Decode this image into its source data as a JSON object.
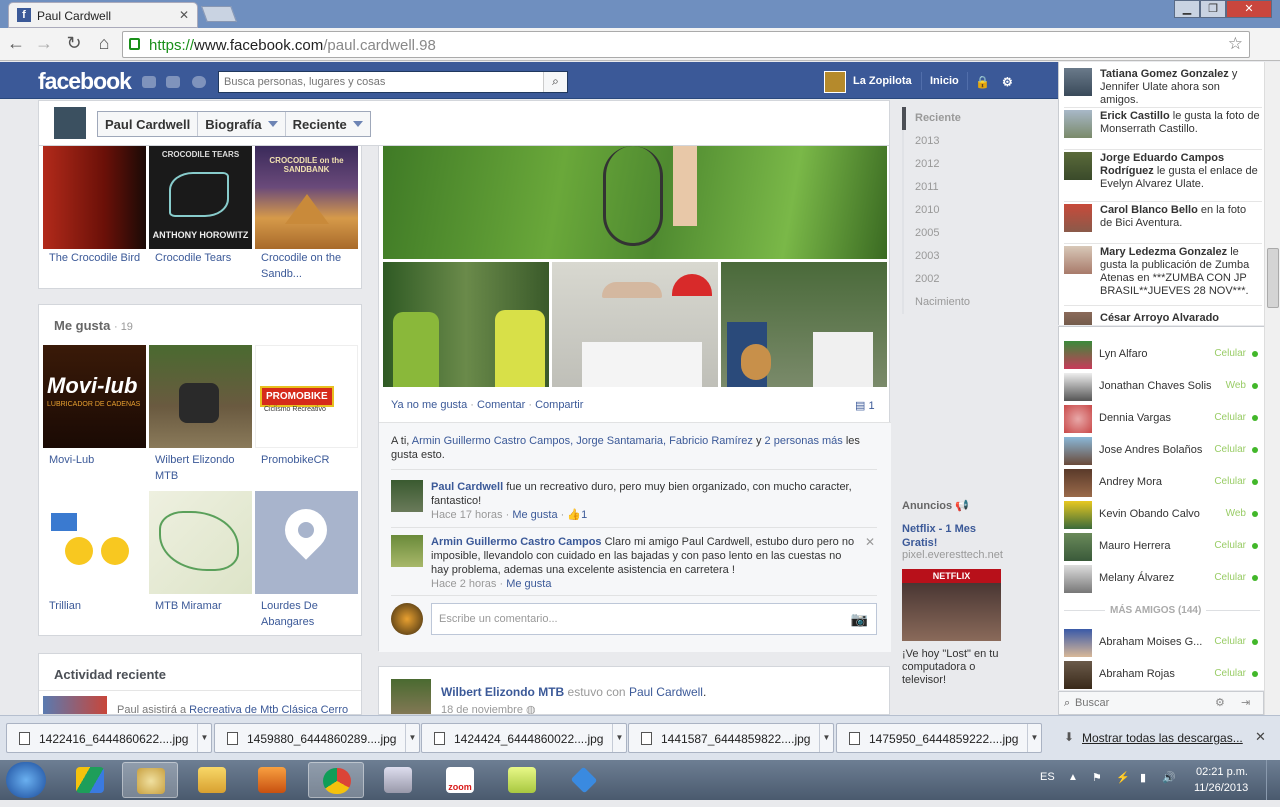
{
  "browser": {
    "tab_title": "Paul Cardwell",
    "url_scheme": "https://",
    "url_host": "www.facebook.com",
    "url_path": "/paul.cardwell.98"
  },
  "fb_header": {
    "logo": "facebook",
    "search_placeholder": "Busca personas, lugares y cosas",
    "user_name": "La Zopilota",
    "home": "Inicio"
  },
  "profile_nav": {
    "name": "Paul Cardwell",
    "section": "Biografía",
    "filter": "Reciente"
  },
  "books": [
    {
      "title": "The Crocodile Bird"
    },
    {
      "title": "Crocodile Tears",
      "cover_text": "CROCODILE TEARS",
      "cover_author": "ANTHONY HOROWITZ"
    },
    {
      "title": "Crocodile on the Sandb...",
      "cover_text": "CROCODILE on the SANDBANK"
    }
  ],
  "likes": {
    "heading": "Me gusta",
    "count": "· 19",
    "items": [
      {
        "name": "Movi-Lub",
        "logo_text": "Movi-lub",
        "logo_sub": "LUBRICADOR DE CADENAS"
      },
      {
        "name": "Wilbert Elizondo MTB"
      },
      {
        "name": "PromobikeCR",
        "logo_text": "PROMOBIKE",
        "logo_sub": "Ciclismo Recreativo"
      },
      {
        "name": "Trillian"
      },
      {
        "name": "MTB Miramar"
      },
      {
        "name": "Lourdes De Abangares"
      }
    ]
  },
  "recent_activity": {
    "heading": "Actividad reciente",
    "item_prefix": "Paul asistirá a ",
    "item_link": "Recreativa de Mtb Clásica Cerro"
  },
  "story": {
    "actions": {
      "unlike": "Ya no me gusta",
      "comment": "Comentar",
      "share": "Compartir",
      "comment_count": "1"
    },
    "likes_prefix": "A ti, ",
    "likes_names": "Armin Guillermo Castro Campos, Jorge Santamaria, Fabricio Ramírez",
    "likes_mid": " y ",
    "likes_others": "2 personas más",
    "likes_suffix": " les gusta esto.",
    "comments": [
      {
        "author": "Paul Cardwell",
        "text": " fue un recreativo duro, pero muy bien organizado, con mucho caracter, fantastico!",
        "time": "Hace 17 horas",
        "like": "Me gusta",
        "likes": "1"
      },
      {
        "author": "Armin Guillermo Castro Campos",
        "text": " Claro mi amigo Paul Cardwell, estubo duro pero no imposible, llevandolo con cuidado en las bajadas y con paso lento en las cuestas no hay problema, ademas una excelente asistencia en carretera !",
        "time": "Hace 2 horas",
        "like": "Me gusta"
      }
    ],
    "comment_placeholder": "Escribe un comentario..."
  },
  "next_story": {
    "author": "Wilbert Elizondo MTB",
    "verb": " estuvo con ",
    "with": "Paul Cardwell",
    "date": "18 de noviembre"
  },
  "timeline_years": [
    "Reciente",
    "2013",
    "2012",
    "2011",
    "2010",
    "2005",
    "2003",
    "2002",
    "Nacimiento"
  ],
  "ads": {
    "heading": "Anuncios",
    "title": "Netflix - 1 Mes Gratis!",
    "domain": "pixel.everesttech.net",
    "image_text": "NETFLIX",
    "body": "¡Ve hoy \"Lost\" en tu computadora o televisor!"
  },
  "ticker": [
    {
      "bold": "Tatiana Gomez Gonzalez",
      "rest": " y Jennifer Ulate ahora son amigos."
    },
    {
      "bold": "Erick Castillo",
      "rest": " le gusta la foto de Monserrath Castillo."
    },
    {
      "bold": "Jorge Eduardo Campos Rodríguez",
      "rest": " le gusta el enlace de Evelyn Alvarez Ulate."
    },
    {
      "bold": "Carol Blanco Bello",
      "rest": " en la foto de Bici Aventura."
    },
    {
      "bold": "Mary Ledezma Gonzalez",
      "rest": " le gusta la publicación de Zumba Atenas en ***ZUMBA CON JP BRASIL**JUEVES 28 NOV***."
    },
    {
      "bold": "César Arroyo Alvarado",
      "rest": ""
    }
  ],
  "chat": {
    "friends": [
      {
        "name": "Lyn Alfaro",
        "status": "Celular"
      },
      {
        "name": "Jonathan Chaves Solis",
        "status": "Web"
      },
      {
        "name": "Dennia Vargas",
        "status": "Celular"
      },
      {
        "name": "Jose Andres Bolaños",
        "status": "Celular"
      },
      {
        "name": "Andrey Mora",
        "status": "Celular"
      },
      {
        "name": "Kevin Obando Calvo",
        "status": "Web"
      },
      {
        "name": "Mauro Herrera",
        "status": "Celular"
      },
      {
        "name": "Melany Álvarez",
        "status": "Celular"
      }
    ],
    "more_heading": "MÁS AMIGOS (144)",
    "more": [
      {
        "name": "Abraham Moises G...",
        "status": "Celular"
      },
      {
        "name": "Abraham Rojas",
        "status": "Celular"
      }
    ],
    "search_placeholder": "Buscar"
  },
  "downloads": {
    "files": [
      "1422416_6444860622....jpg",
      "1459880_6444860289....jpg",
      "1424424_6444860022....jpg",
      "1441587_6444859822....jpg",
      "1475950_6444859222....jpg"
    ],
    "show_all": "Mostrar todas las descargas..."
  },
  "taskbar": {
    "lang": "ES",
    "time": "02:21 p.m.",
    "date": "11/26/2013",
    "zoom_label": "zoom"
  }
}
